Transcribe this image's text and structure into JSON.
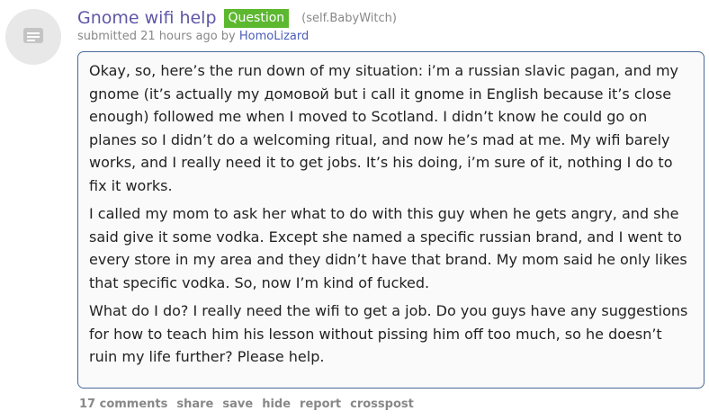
{
  "post": {
    "thumbnail_icon": "self-post-icon",
    "title": "Gnome wifi help",
    "flair": "Question",
    "domain": "(self.BabyWitch)",
    "tagline": {
      "prefix": "submitted 21 hours ago by",
      "author": "HomoLizard"
    },
    "body": [
      "Okay, so, here’s the run down of my situation: i’m a russian slavic pagan, and my gnome (it’s actually my домовой but i call it gnome in English because it’s close enough) followed me when I moved to Scotland. I didn’t know he could go on planes so I didn’t do a welcoming ritual, and now he’s mad at me. My wifi barely works, and I really need it to get jobs. It’s his doing, i’m sure of it, nothing I do to fix it works.",
      "I called my mom to ask her what to do with this guy when he gets angry, and she said give it some vodka. Except she named a specific russian brand, and I went to every store in my area and they didn’t have that brand. My mom said he only likes that specific vodka. So, now I’m kind of fucked.",
      "What do I do? I really need the wifi to get a job. Do you guys have any suggestions for how to teach him his lesson without pissing him off too much, so he doesn’t ruin my life further? Please help."
    ],
    "buttons": {
      "comments": "17 comments",
      "share": "share",
      "save": "save",
      "hide": "hide",
      "report": "report",
      "crosspost": "crosspost"
    }
  },
  "colors": {
    "title": "#5f56a6",
    "flair_bg": "#5cb82f",
    "author": "#4a5db8",
    "muted": "#888888",
    "selftext_border": "#4a6a9a"
  }
}
